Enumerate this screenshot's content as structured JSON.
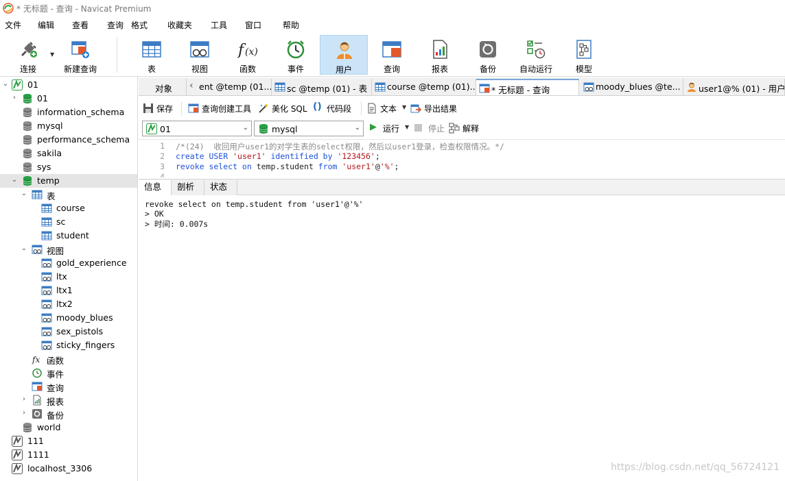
{
  "window": {
    "title": "* 无标题 - 查询 - Navicat Premium"
  },
  "menu": [
    "文件",
    "编辑",
    "查看",
    "查询",
    "格式",
    "收藏夹",
    "工具",
    "窗口",
    "帮助"
  ],
  "toolbar": {
    "connect": "连接",
    "new_query": "新建查询",
    "table": "表",
    "view": "视图",
    "function": "函数",
    "event": "事件",
    "user": "用户",
    "query": "查询",
    "report": "报表",
    "backup": "备份",
    "autorun": "自动运行",
    "model": "模型"
  },
  "sidebar": {
    "conn_01": "01",
    "db_01": "01",
    "db_information_schema": "information_schema",
    "db_mysql": "mysql",
    "db_performance_schema": "performance_schema",
    "db_sakila": "sakila",
    "db_sys": "sys",
    "db_temp": "temp",
    "group_tables": "表",
    "table_course": "course",
    "table_sc": "sc",
    "table_student": "student",
    "group_views": "视图",
    "view_gold_experience": "gold_experience",
    "view_ltx": "ltx",
    "view_ltx1": "ltx1",
    "view_ltx2": "ltx2",
    "view_moody_blues": "moody_blues",
    "view_sex_pistols": "sex_pistols",
    "view_sticky_fingers": "sticky_fingers",
    "group_functions": "函数",
    "group_events": "事件",
    "group_queries": "查询",
    "group_reports": "报表",
    "group_backups": "备份",
    "db_world": "world",
    "conn_111": "111",
    "conn_1111": "1111",
    "conn_localhost": "localhost_3306"
  },
  "tabs": {
    "objects": "对象",
    "t1": "ent @temp (01...",
    "t2": "sc @temp (01) - 表",
    "t3": "course @temp (01)...",
    "t4": "* 无标题 - 查询",
    "t5": "moody_blues @te...",
    "t6": "user1@% (01) - 用户"
  },
  "query_toolbar": {
    "save": "保存",
    "builder": "查询创建工具",
    "beautify": "美化 SQL",
    "snippet": "代码段",
    "text": "文本",
    "export": "导出结果"
  },
  "connection_bar": {
    "connection": "01",
    "database": "mysql",
    "run": "运行",
    "stop": "停止",
    "explain": "解释"
  },
  "editor": {
    "line_numbers": [
      "1",
      "2",
      "3",
      "4"
    ],
    "l1_comment": "/*(24)  收回用户user1的对学生表的select权限，然后以user1登录，检查权限情况。*/",
    "l2_kw1": "create USER",
    "l2_sp1": " ",
    "l2_str1": "'user1'",
    "l2_kw2": " identified by ",
    "l2_str2": "'123456'",
    "l2_end": ";",
    "l3_kw1": "revoke select on",
    "l3_plain": " temp.student ",
    "l3_kw2": "from",
    "l3_sp": " ",
    "l3_str1": "'user1'",
    "l3_at": "@",
    "l3_str2": "'%'",
    "l3_end": ";"
  },
  "result_tabs": {
    "info": "信息",
    "profile": "剖析",
    "status": "状态"
  },
  "result": {
    "line1": "revoke select on temp.student from 'user1'@'%'",
    "line2": "> OK",
    "line3": "> 时间: 0.007s"
  },
  "watermark": "https://blog.csdn.net/qq_56724121",
  "colors": {
    "keyword": "#1d4fd8",
    "string": "#b4161b",
    "comment": "#8a8a8a",
    "db_green": "#1f9d3a",
    "accent": "#cce4f7"
  }
}
